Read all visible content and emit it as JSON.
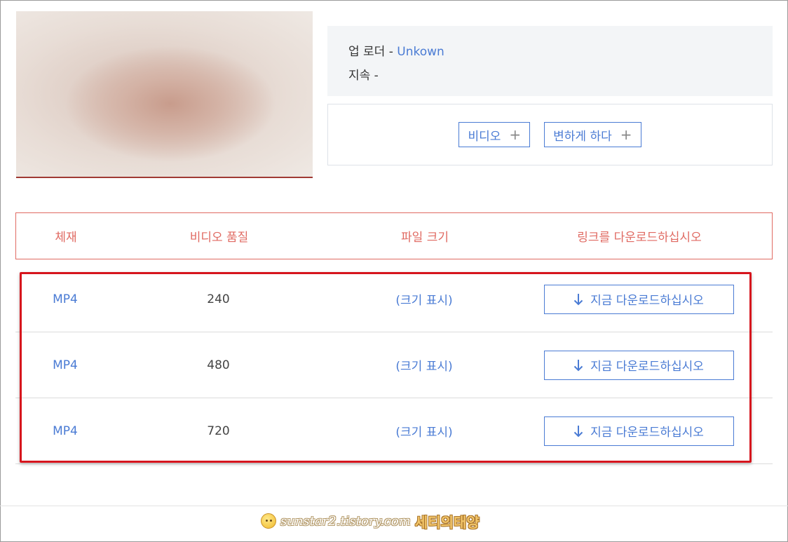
{
  "info": {
    "uploader_label": "업 로더 -",
    "uploader_value": "Unkown",
    "duration_label": "지속 -"
  },
  "convert": {
    "video_label": "비디오",
    "convert_label": "변하게 하다"
  },
  "table": {
    "headers": [
      "체재",
      "비디오 품질",
      "파일 크기",
      "링크를 다운로드하십시오"
    ],
    "rows": [
      {
        "format": "MP4",
        "quality": "240",
        "size": "(크기 표시)",
        "download": "지금 다운로드하십시오"
      },
      {
        "format": "MP4",
        "quality": "480",
        "size": "(크기 표시)",
        "download": "지금 다운로드하십시오"
      },
      {
        "format": "MP4",
        "quality": "720",
        "size": "(크기 표시)",
        "download": "지금 다운로드하십시오"
      }
    ]
  },
  "watermark": {
    "url": "sunstar2.tistory.com",
    "name": "세티의태양"
  },
  "colors": {
    "accent_blue": "#4a7bd4",
    "header_red": "#e06a62",
    "highlight_red": "#d6151d"
  }
}
